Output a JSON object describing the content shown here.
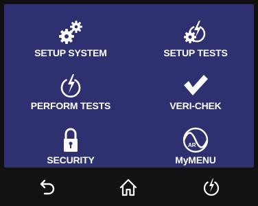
{
  "menu": {
    "items": [
      {
        "label": "SETUP SYSTEM",
        "icon": "gears-icon"
      },
      {
        "label": "SETUP TESTS",
        "icon": "gear-power-icon"
      },
      {
        "label": "PERFORM TESTS",
        "icon": "power-bolt-icon"
      },
      {
        "label": "VERI-CHEK",
        "icon": "checkmark-icon"
      },
      {
        "label": "SECURITY",
        "icon": "padlock-icon"
      },
      {
        "label": "MyMENU",
        "icon": "ar-logo-icon"
      }
    ],
    "mymenu_logo_text": "AR"
  },
  "navbar": {
    "buttons": [
      {
        "icon": "back-arrow-icon"
      },
      {
        "icon": "home-icon"
      },
      {
        "icon": "power-icon"
      }
    ]
  },
  "colors": {
    "screen_background": "#2e3070",
    "bezel": "#101010",
    "foreground": "#ffffff"
  }
}
